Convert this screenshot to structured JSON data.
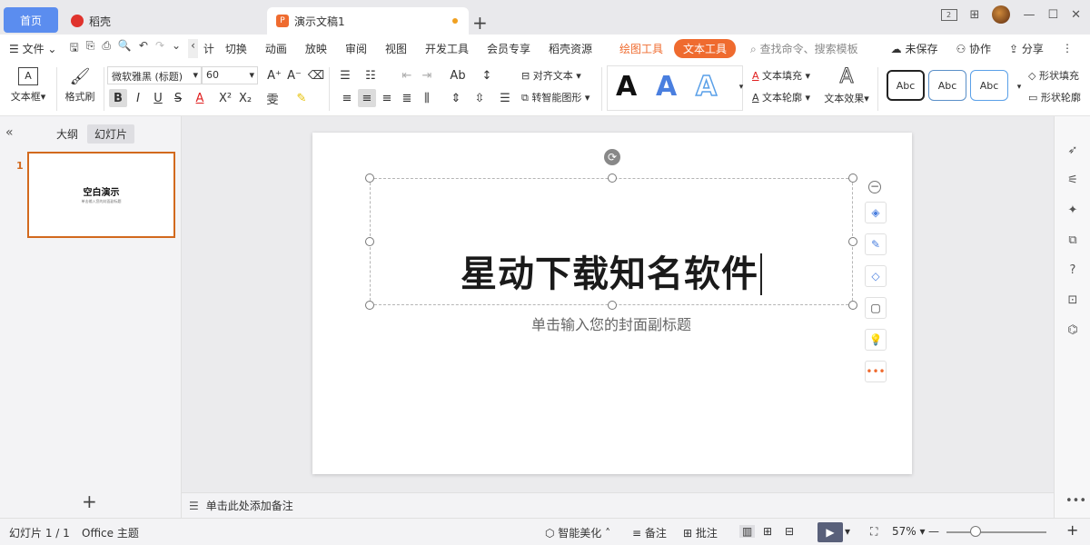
{
  "tabs": {
    "home": "首页",
    "daoke": "稻壳",
    "doc": "演示文稿1",
    "add": "+"
  },
  "menubar": {
    "file": "文件",
    "items": [
      "计",
      "切换",
      "动画",
      "放映",
      "审阅",
      "视图",
      "开发工具",
      "会员专享",
      "稻壳资源"
    ],
    "draw_tool": "绘图工具",
    "text_tool": "文本工具",
    "search_placeholder": "查找命令、搜索模板",
    "unsaved": "未保存",
    "collab": "协作",
    "share": "分享"
  },
  "ribbon": {
    "textbox": "文本框",
    "format_painter": "格式刷",
    "font_name": "微软雅黑 (标题)",
    "font_size": "60",
    "align_text": "对齐文本",
    "smartart": "转智能图形",
    "text_fill": "文本填充",
    "text_outline": "文本轮廓",
    "text_effect": "文本效果",
    "shape_fill": "形状填充",
    "shape_outline": "形状轮廓",
    "wordart": [
      "A",
      "A",
      "A"
    ],
    "abc": [
      "Abc",
      "Abc",
      "Abc"
    ]
  },
  "leftpane": {
    "outline_tab": "大纲",
    "slides_tab": "幻灯片",
    "slide_number": "1",
    "thumb_title": "空白演示",
    "thumb_subtitle": "单击输入您的封面副标题",
    "add": "+"
  },
  "slide": {
    "title": "星动下载知名软件",
    "subtitle": "单击输入您的封面副标题"
  },
  "notes": {
    "placeholder": "单击此处添加备注"
  },
  "status": {
    "slide_info": "幻灯片 1 / 1",
    "theme": "Office 主题",
    "beautify": "智能美化",
    "notes": "备注",
    "comments": "批注",
    "zoom": "57%"
  },
  "colors": {
    "accent_blue": "#5b8def",
    "tab_orange": "#ef6b2f",
    "selection_border": "#d2691e"
  }
}
